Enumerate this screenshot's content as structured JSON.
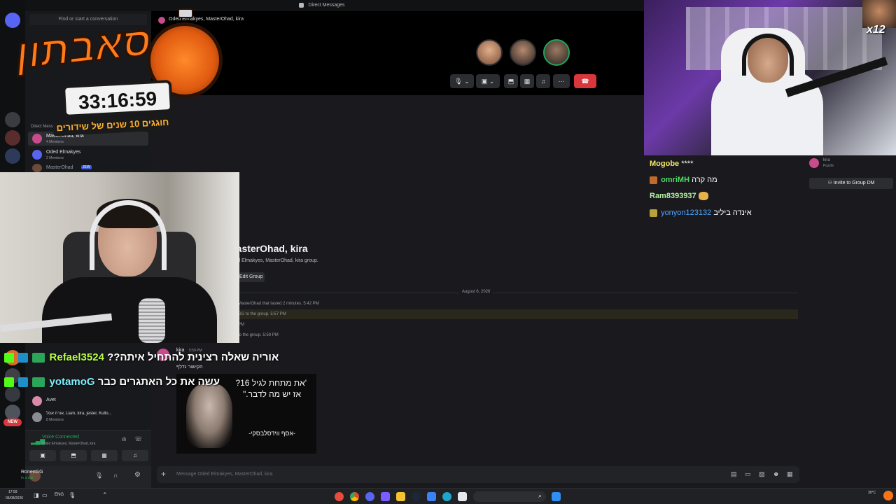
{
  "window": {
    "title": "Direct Messages"
  },
  "dm_list": {
    "search_placeholder": "Find or start a conversation",
    "section_title": "Direct Messages",
    "items": [
      {
        "name": "MasterOhad, kira",
        "sub": "4 Members"
      },
      {
        "name": "Oded Elmakyes",
        "sub": "2 Members"
      },
      {
        "name": "MasterOhad",
        "badge": "JEW"
      },
      {
        "name": "Avet",
        "sub": ""
      },
      {
        "name": "אורח אסל, Liam, kira, jester, Kullo...",
        "sub": "8 Members"
      }
    ],
    "new_badge": "NEW"
  },
  "voice_panel": {
    "status": "Voice Connected",
    "channel": "Oded Elmakyes, MasterOhad, kira"
  },
  "user_panel": {
    "name": "RonenGG",
    "status": "In a call"
  },
  "call_header": {
    "title": "Oded Elmakyes, MasterOhad, kira"
  },
  "group": {
    "title": "MasterOhad, kira",
    "subtitle": "Oded Elmakyes, MasterOhad, kira group.",
    "edit_button": "Edit Group",
    "date_divider": "August 6, 2026",
    "sys_messages": [
      "MasterOhad that lasted 2 minutes. 5:42 PM",
      "GG to the group. 5:57 PM",
      "PM",
      "to the group. 5:59 PM"
    ],
    "message_author": "kira",
    "message_time": "5:59 PM",
    "reply_text": "הקישור נדלף",
    "message_placeholder": "Message Oded Elmakyes, MasterOhad, kira"
  },
  "quote_card": {
    "line1": "'את מתחת לגיל 16?",
    "line2": "אז יש מה לדבר.\"",
    "signature": "-אסף ווידסלבסקי-"
  },
  "member_side": {
    "user": "kira",
    "status": "Puzzle",
    "invite_button": "Invite to Group DM"
  },
  "stream_logo": {
    "title": "סאבתון",
    "timer": "33:16:59",
    "tagline": "חוגגים 10 שנים של שידורים"
  },
  "webcam_right": {
    "multiplier": "x12"
  },
  "twitch_chat": [
    {
      "user": "Mogobe",
      "msg": "****",
      "color": "#f5e663"
    },
    {
      "user": "omriMH",
      "msg": "מה קרה",
      "color": "#4cd964"
    },
    {
      "user": "Ram8393937",
      "msg": "",
      "color": "#b6f2a2"
    },
    {
      "user": "yonyon123132",
      "msg": "אינדה ביליב",
      "color": "#4aa3ff"
    }
  ],
  "kick_chat": [
    {
      "user": "Refael3524",
      "msg": "??אוריה שאלה רצינית להתחיל איתה",
      "color": "#b7ff4a"
    },
    {
      "user": "yotamoG",
      "msg": "עשה את כל האתגרים כבר",
      "color": "#7df0ff"
    }
  ],
  "taskbar": {
    "time": "17:59",
    "date": "06/08/2026",
    "weather": "30°C"
  },
  "colors": {
    "discord_bg": "#1e1f22",
    "hangup": "#da373c",
    "accent": "#5865f2"
  }
}
